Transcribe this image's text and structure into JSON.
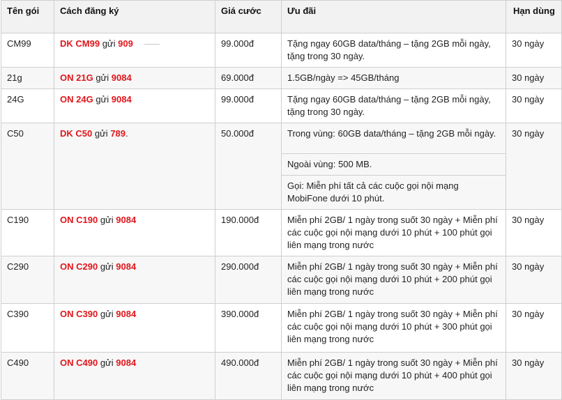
{
  "headers": {
    "name": "Tên gói",
    "register": "Cách đăng ký",
    "price": "Giá cước",
    "offer": "Ưu đãi",
    "duration": "Hạn dùng"
  },
  "rows": [
    {
      "name": "CM99",
      "cmd": "DK  CM99",
      "send": "gửi",
      "num": "909",
      "price": "99.000đ",
      "offer": "Tặng ngay 60GB data/tháng – tặng 2GB mỗi ngày, tặng trong 30 ngày.",
      "duration": "30 ngày"
    },
    {
      "name": "21g",
      "cmd": "ON  21G",
      "send": "gửi",
      "num": "9084",
      "price": "69.000đ",
      "offer": "1.5GB/ngày => 45GB/tháng",
      "duration": "30 ngày"
    },
    {
      "name": "24G",
      "cmd": "ON  24G",
      "send": "gửi",
      "num": "9084",
      "price": "99.000đ",
      "offer": "Tặng ngay 60GB data/tháng – tặng 2GB mỗi ngày, tặng trong 30 ngày.",
      "duration": "30 ngày"
    },
    {
      "name": "C50",
      "cmd": "DK C50",
      "send": "gửi",
      "num": "789",
      "suffix": ".",
      "price": "50.000đ",
      "offer": "Trong vùng: 60GB data/tháng – tặng 2GB mỗi ngày.",
      "offer2": "Ngoài vùng: 500 MB.",
      "offer3": "Gọi: Miễn phí tất cả các cuộc gọi nội mạng MobiFone dưới 10 phút.",
      "duration": "30 ngày"
    },
    {
      "name": "C190",
      "cmd": "ON C190",
      "send": "gửi",
      "num": "9084",
      "price": "190.000đ",
      "offer": "Miễn phí 2GB/ 1 ngày trong suốt 30 ngày +  Miễn phí các cuộc gọi nội mạng dưới 10 phút +  100 phút gọi liên mạng trong nước",
      "duration": "30 ngày"
    },
    {
      "name": "C290",
      "cmd": "ON C290",
      "send": "gửi",
      "num": "9084",
      "price": "290.000đ",
      "offer": "Miễn phí 2GB/ 1 ngày trong suốt 30 ngày +  Miễn phí các cuộc gọi nội mạng dưới 10 phút +  200 phút gọi liên mạng trong nước",
      "duration": "30 ngày"
    },
    {
      "name": "C390",
      "cmd": "ON C390",
      "send": "gửi",
      "num": "9084",
      "price": "390.000đ",
      "offer": "Miễn phí 2GB/ 1 ngày trong suốt 30 ngày +  Miễn phí các cuộc gọi nội mạng dưới 10 phút +  300 phút gọi liên mạng trong nước",
      "duration": "30 ngày"
    },
    {
      "name": "C490",
      "cmd": "ON C490",
      "send": "gửi",
      "num": "9084",
      "price": "490.000đ",
      "offer": "Miễn phí 2GB/ 1 ngày trong suốt 30 ngày +  Miễn phí các cuộc gọi nội mạng dưới 10 phút +  400 phút gọi liên mạng trong nước",
      "duration": "30 ngày"
    }
  ]
}
